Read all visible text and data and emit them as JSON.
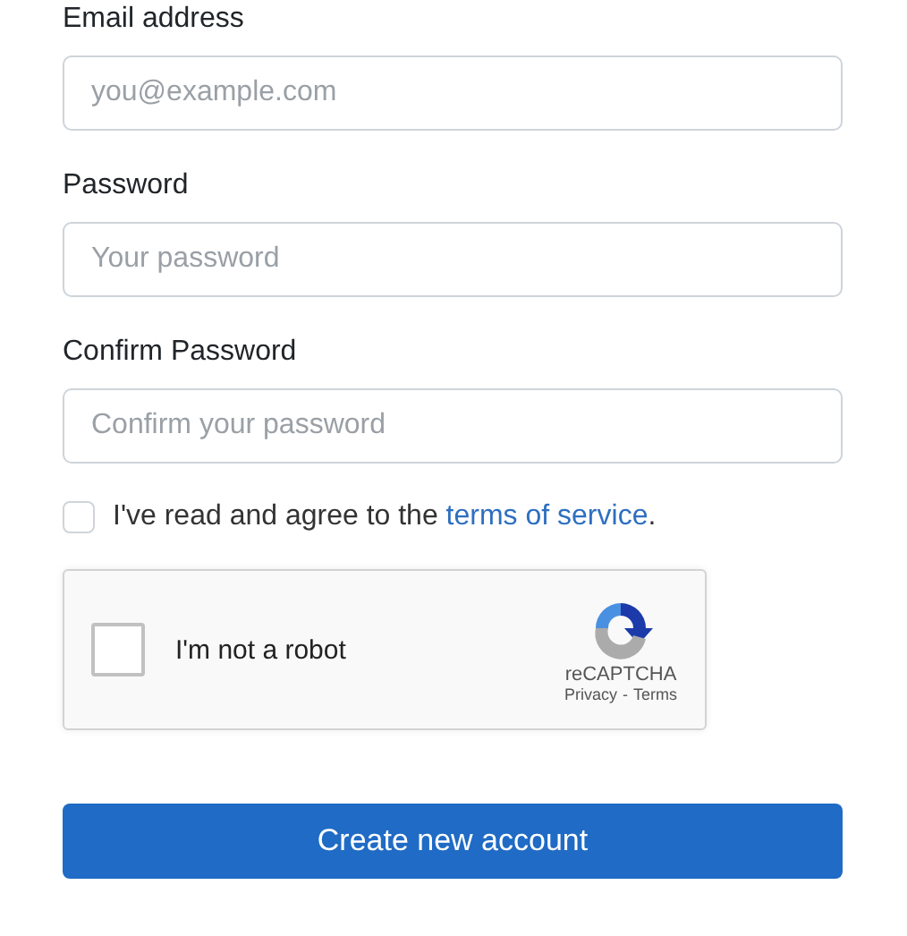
{
  "fields": [
    {
      "label": "Email address",
      "placeholder": "you@example.com"
    },
    {
      "label": "Password",
      "placeholder": "Your password"
    },
    {
      "label": "Confirm Password",
      "placeholder": "Confirm your password"
    }
  ],
  "terms": {
    "checked": false,
    "text": "I've read and agree to the",
    "link": "terms of service",
    "end": "."
  },
  "captcha": {
    "checked": false,
    "label": "I'm not a robot",
    "brand": "reCAPTCHA",
    "privacy": "Privacy",
    "separator": "-",
    "terms": "Terms"
  },
  "submit": {
    "label": "Create new account"
  }
}
